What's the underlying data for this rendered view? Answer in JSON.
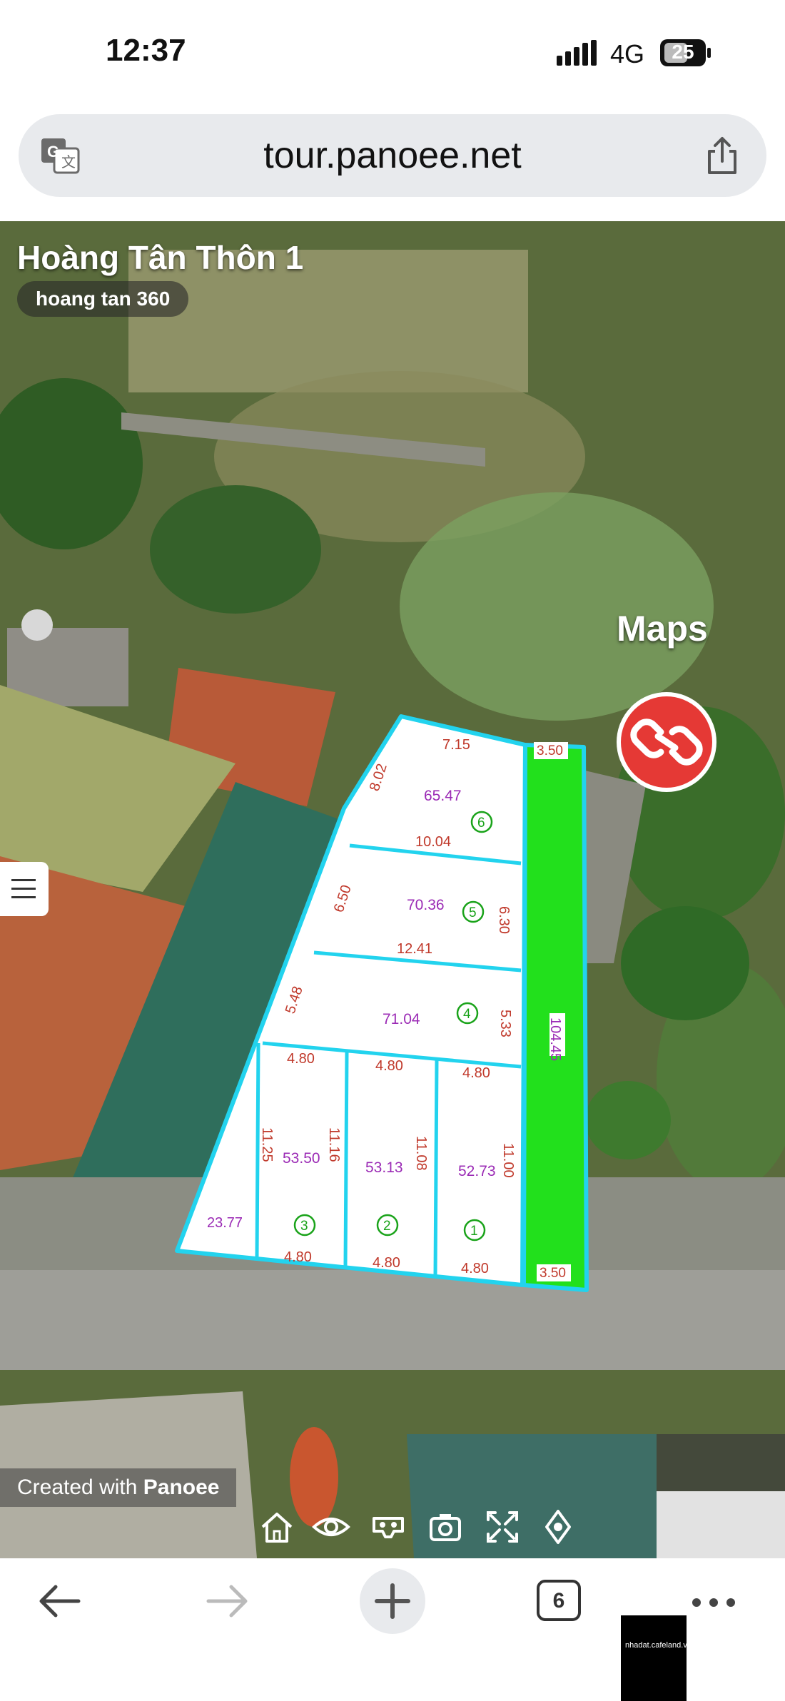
{
  "status": {
    "time": "12:37",
    "network": "4G",
    "battery": "25"
  },
  "browser": {
    "url": "tour.panoee.net",
    "tab_count": "6"
  },
  "tour": {
    "title": "Hoàng Tân Thôn 1",
    "scene_name": "hoang tan 360",
    "maps_label": "Maps",
    "created_prefix": "Created with ",
    "created_brand": "Panoee"
  },
  "plot_map": {
    "lots": [
      {
        "number": "6",
        "area": "65.47",
        "top": "7.15",
        "left": "8.02",
        "bottom": "10.04"
      },
      {
        "number": "5",
        "area": "70.36",
        "left": "6.50",
        "right": "6.30",
        "bottom": "12.41"
      },
      {
        "number": "4",
        "area": "71.04",
        "left": "5.48",
        "right": "5.33"
      },
      {
        "number": "3",
        "area": "53.50",
        "top": "4.80",
        "right": "11.16",
        "bottom": "4.80",
        "left_side": "11.25"
      },
      {
        "number": "2",
        "area": "53.13",
        "top": "4.80",
        "right": "11.08",
        "bottom": "4.80"
      },
      {
        "number": "1",
        "area": "52.73",
        "top": "4.80",
        "right": "11.00",
        "bottom": "4.80"
      }
    ],
    "triangle_edge": "23.77",
    "road_width_top": "3.50",
    "road_width_bottom": "3.50",
    "road_length": "104.45"
  },
  "colors": {
    "lot_border": "#22d3ee",
    "road": "#22e01c",
    "label_red": "#c0392b",
    "label_purple": "#9b2bb5",
    "link_button": "#e53935"
  },
  "icons": [
    "translate-icon",
    "share-icon",
    "link-icon",
    "menu-icon",
    "home-icon",
    "eye-icon",
    "vr-icon",
    "camera-icon",
    "fullscreen-icon",
    "gyro-icon",
    "back-arrow-icon",
    "forward-arrow-icon",
    "plus-icon",
    "more-icon"
  ]
}
